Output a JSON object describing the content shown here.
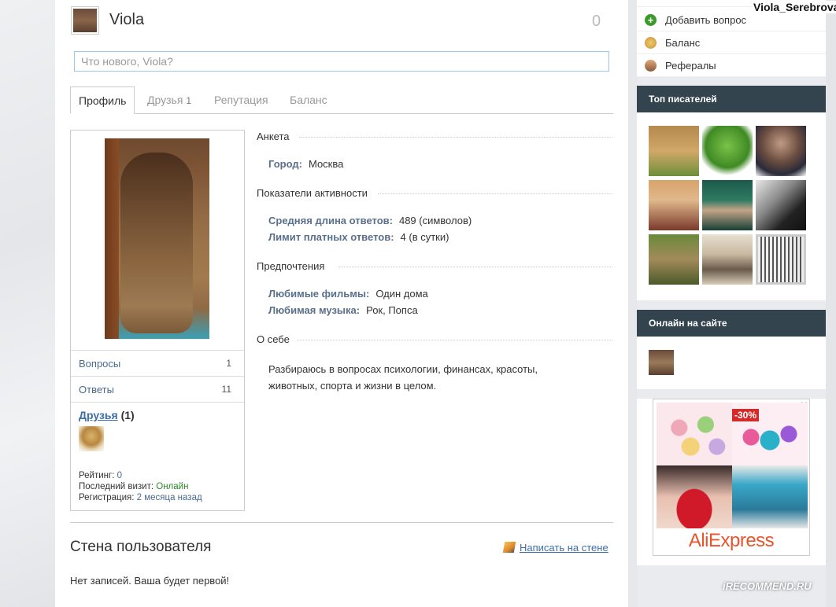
{
  "header": {
    "name": "Viola",
    "count": "0",
    "status_placeholder": "Что нового, Viola?"
  },
  "tabs": [
    {
      "label": "Профиль",
      "count": ""
    },
    {
      "label": "Друзья",
      "count": "1"
    },
    {
      "label": "Репутация",
      "count": ""
    },
    {
      "label": "Баланс",
      "count": ""
    }
  ],
  "profile_card": {
    "stats": [
      {
        "label": "Вопросы",
        "value": "1"
      },
      {
        "label": "Ответы",
        "value": "11"
      }
    ],
    "friends_label": "Друзья",
    "friends_count": "(1)",
    "rating_label": "Рейтинг:",
    "rating_value": "0",
    "last_visit_label": "Последний визит:",
    "last_visit_value": "Онлайн",
    "registration_label": "Регистрация:",
    "registration_value": "2 месяца назад"
  },
  "sections": {
    "anketa": "Анкета",
    "activity": "Показатели активности",
    "preferences": "Предпочтения",
    "about": "О себе"
  },
  "fields": {
    "city_label": "Город:",
    "city_value": "Москва",
    "avg_len_label": "Средняя длина ответов:",
    "avg_len_value": "489 (символов)",
    "limit_label": "Лимит платных ответов:",
    "limit_value": "4 (в сутки)",
    "films_label": "Любимые фильмы:",
    "films_value": "Один дома",
    "music_label": "Любимая музыка:",
    "music_value": "Рок, Попса",
    "about_text": "Разбираюсь в вопросах психологии, финансах, красоты, животных, спорта и жизни в целом."
  },
  "wall": {
    "title": "Стена пользователя",
    "write_link": "Написать на стене",
    "empty": "Нет записей. Ваша будет первой!"
  },
  "sidebar": {
    "username": "Viola_Serebrova",
    "menu": [
      {
        "label": "Добавить вопрос",
        "icon": "plus-icon"
      },
      {
        "label": "Баланс",
        "icon": "coin-icon"
      },
      {
        "label": "Рефералы",
        "icon": "users-icon"
      }
    ],
    "top_writers_title": "Топ писателей",
    "online_title": "Онлайн на сайте"
  },
  "ad": {
    "logo": "AliExpress",
    "badge": "-30%",
    "close": "✕"
  },
  "watermark": "iRECOMMEND.RU"
}
